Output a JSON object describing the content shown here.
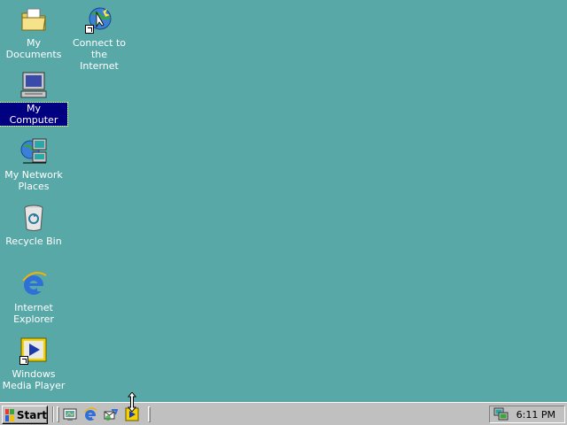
{
  "desktop": {
    "background": "#58a8a8",
    "icons": [
      {
        "label": "My Documents",
        "icon": "folder-documents-icon"
      },
      {
        "label": "Connect to the\nInternet",
        "icon": "connect-internet-icon"
      },
      {
        "label": "My Computer",
        "icon": "computer-icon",
        "selected": true
      },
      {
        "label": "My Network\nPlaces",
        "icon": "network-places-icon"
      },
      {
        "label": "Recycle Bin",
        "icon": "recycle-bin-icon"
      },
      {
        "label": "Internet\nExplorer",
        "icon": "internet-explorer-icon"
      },
      {
        "label": "Windows\nMedia Player",
        "icon": "media-player-icon"
      }
    ]
  },
  "taskbar": {
    "start_label": "Start",
    "quick_launch": [
      "show-desktop-icon",
      "internet-explorer-icon",
      "outlook-express-icon",
      "media-player-icon"
    ],
    "tray": {
      "icons": [
        "network-status-icon"
      ],
      "clock": "6:11 PM"
    }
  }
}
